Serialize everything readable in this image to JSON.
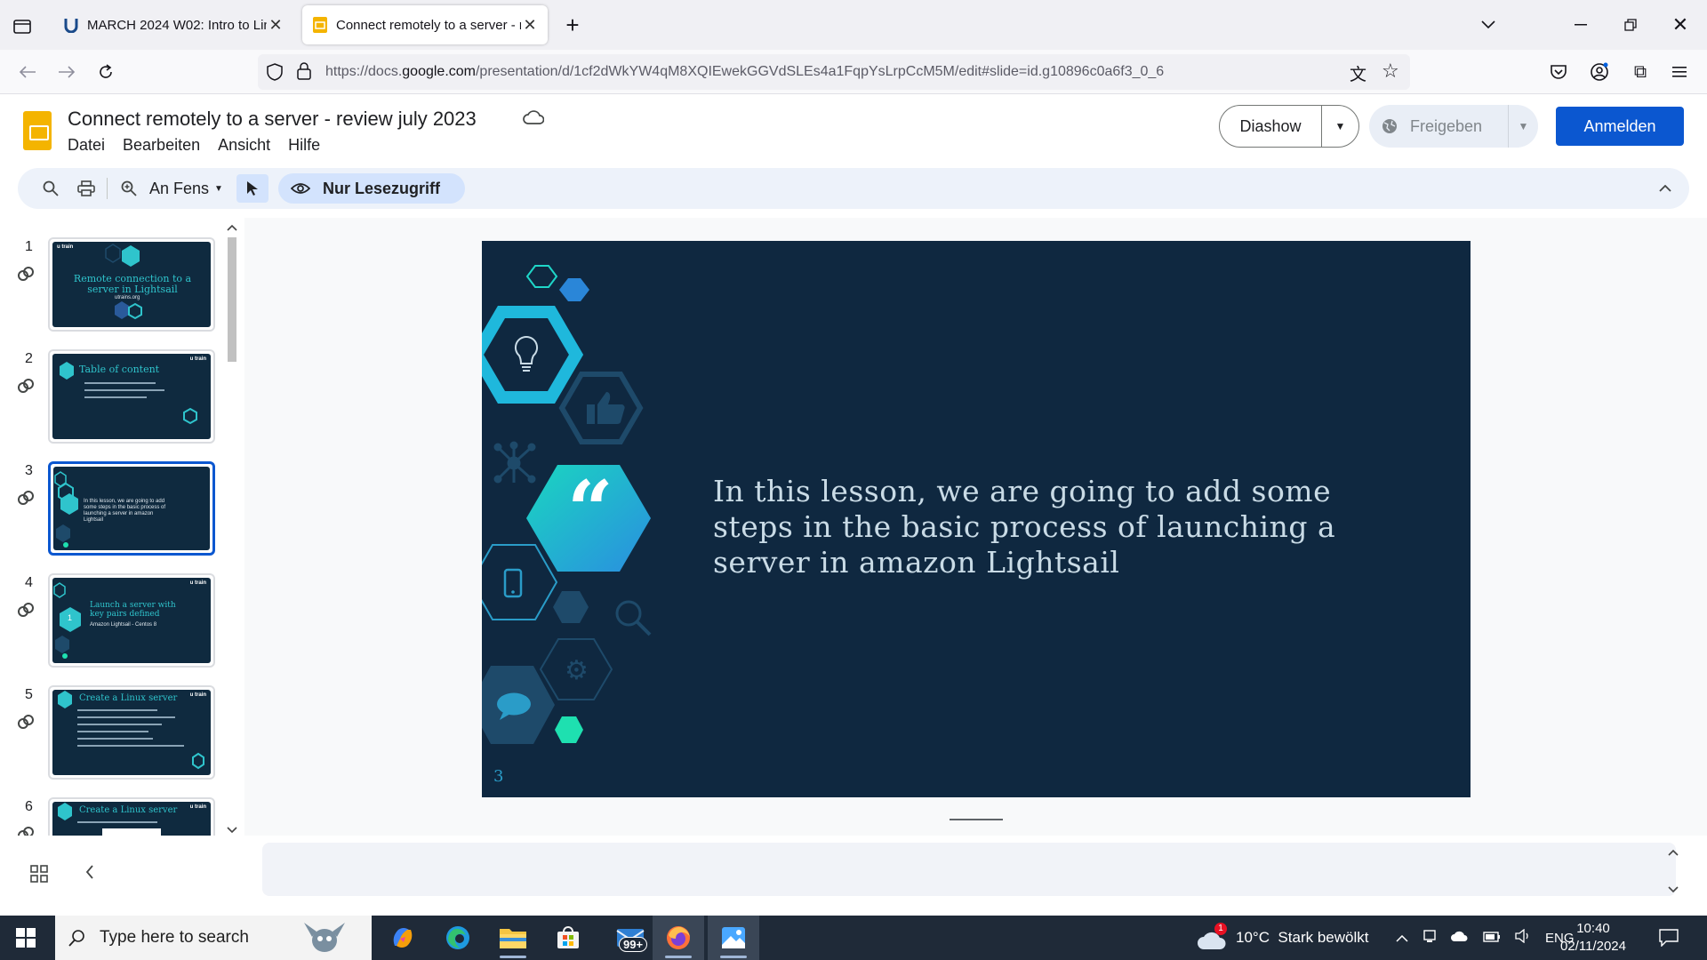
{
  "browser": {
    "tabs": [
      {
        "title": "MARCH 2024 W02: Intro to Linu",
        "active": false
      },
      {
        "title": "Connect remotely to a server - r",
        "active": true
      }
    ],
    "new_tab": "+",
    "url_prefix": "https://docs.",
    "url_domain": "google.com",
    "url_rest": "/presentation/d/1cf2dWkYW4qM8XQIEwekGGVdSLEs4a1FqpYsLrpCcM5M/edit#slide=id.g10896c0a6f3_0_6"
  },
  "docs": {
    "title": "Connect remotely to a server - review july 2023",
    "menu": [
      "Datei",
      "Bearbeiten",
      "Ansicht",
      "Hilfe"
    ],
    "diashow_label": "Diashow",
    "freigeben_label": "Freigeben",
    "anmelden_label": "Anmelden"
  },
  "toolbar": {
    "zoom_label": "An Fens",
    "readonly_label": "Nur Lesezugriff"
  },
  "filmstrip": {
    "slides": [
      {
        "num": "1",
        "title": "Remote connection to a server in Lightsail",
        "sub": "utrains.org"
      },
      {
        "num": "2",
        "title": "Table of content",
        "sub": ""
      },
      {
        "num": "3",
        "title": "",
        "sub": "In this lesson, we are going to add some steps in the basic process of launching a server in amazon Lightsail"
      },
      {
        "num": "4",
        "title": "Launch a server with key pairs defined",
        "sub": "Amazon Lightsail - Centos 8"
      },
      {
        "num": "5",
        "title": "Create a Linux server",
        "sub": ""
      },
      {
        "num": "6",
        "title": "Create a Linux server",
        "sub": ""
      }
    ],
    "thumb_numeral": "1",
    "brand": "u train"
  },
  "slide": {
    "quote_mark": "“",
    "text": "In this lesson, we are going to add some steps in the basic process of launching a server in amazon Lightsail",
    "number": "3"
  },
  "taskbar": {
    "search_placeholder": "Type here to search",
    "mail_badge": "99+",
    "weather_badge": "1",
    "weather": "10°C  Stark bewölkt",
    "language": "ENG",
    "time": "10:40",
    "date": "02/11/2024"
  }
}
